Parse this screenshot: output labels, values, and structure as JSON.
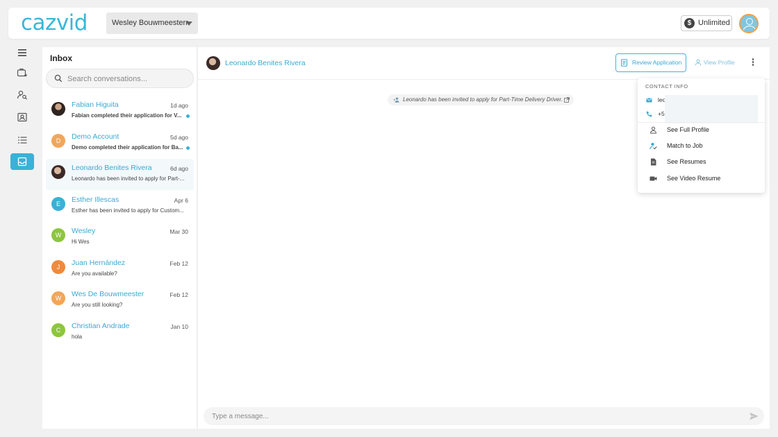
{
  "app": {
    "logo": "cazvid",
    "brand_color": "#39b7d9"
  },
  "header": {
    "company": "Wesley Bouwmeesterr",
    "plan": "Unlimited",
    "plan_icon": "dollar-icon"
  },
  "rail": {
    "items": [
      {
        "name": "menu-icon"
      },
      {
        "name": "add-job-icon"
      },
      {
        "name": "search-candidates-icon"
      },
      {
        "name": "contacts-icon"
      },
      {
        "name": "list-icon"
      },
      {
        "name": "inbox-icon",
        "active": true
      }
    ]
  },
  "inbox": {
    "title": "Inbox",
    "search_placeholder": "Search conversations...",
    "conversations": [
      {
        "name": "Fabian Higuita",
        "date": "1d ago",
        "preview": "Fabian completed their application for V...",
        "unread": true,
        "initial": "",
        "color": "#4b3a2f"
      },
      {
        "name": "Demo Account",
        "date": "5d ago",
        "preview": "Demo completed their application for Ba...",
        "unread": true,
        "initial": "D",
        "color": "#f2a65a"
      },
      {
        "name": "Leonardo Benites Rivera",
        "date": "6d ago",
        "preview": "Leonardo has been invited to apply for Part-...",
        "unread": false,
        "initial": "",
        "color": "#3a2a28",
        "active": true
      },
      {
        "name": "Esther Illescas",
        "date": "Apr 6",
        "preview": "Esther has been invited to apply for Custom...",
        "unread": false,
        "initial": "E",
        "color": "#3ab1d7"
      },
      {
        "name": "Wesley",
        "date": "Mar 30",
        "preview": "Hi Wes",
        "unread": false,
        "initial": "W",
        "color": "#8dc63f"
      },
      {
        "name": "Juan Hernández",
        "date": "Feb 12",
        "preview": "Are you available?",
        "unread": false,
        "initial": "J",
        "color": "#f08a3c"
      },
      {
        "name": "Wes De Bouwmeester",
        "date": "Feb 12",
        "preview": "Are you still looking?",
        "unread": false,
        "initial": "W",
        "color": "#f2a65a"
      },
      {
        "name": "Christian Andrade",
        "date": "Jan 10",
        "preview": "hola",
        "unread": false,
        "initial": "C",
        "color": "#8dc63f"
      }
    ]
  },
  "chat": {
    "contact_name": "Leonardo Benites Rivera",
    "review_button": "Review Application",
    "view_profile": "View Profile",
    "system_message": "Leonardo has been invited to apply for Part-Time Delivery Driver.",
    "composer_placeholder": "Type a message..."
  },
  "menu": {
    "header": "CONTACT INFO",
    "email_partial": "leo",
    "phone_partial": "+5",
    "items": [
      {
        "label": "See Full Profile",
        "icon": "person-icon"
      },
      {
        "label": "Match to Job",
        "icon": "match-icon"
      },
      {
        "label": "See Resumes",
        "icon": "document-icon"
      },
      {
        "label": "See Video Resume",
        "icon": "video-icon"
      }
    ]
  }
}
